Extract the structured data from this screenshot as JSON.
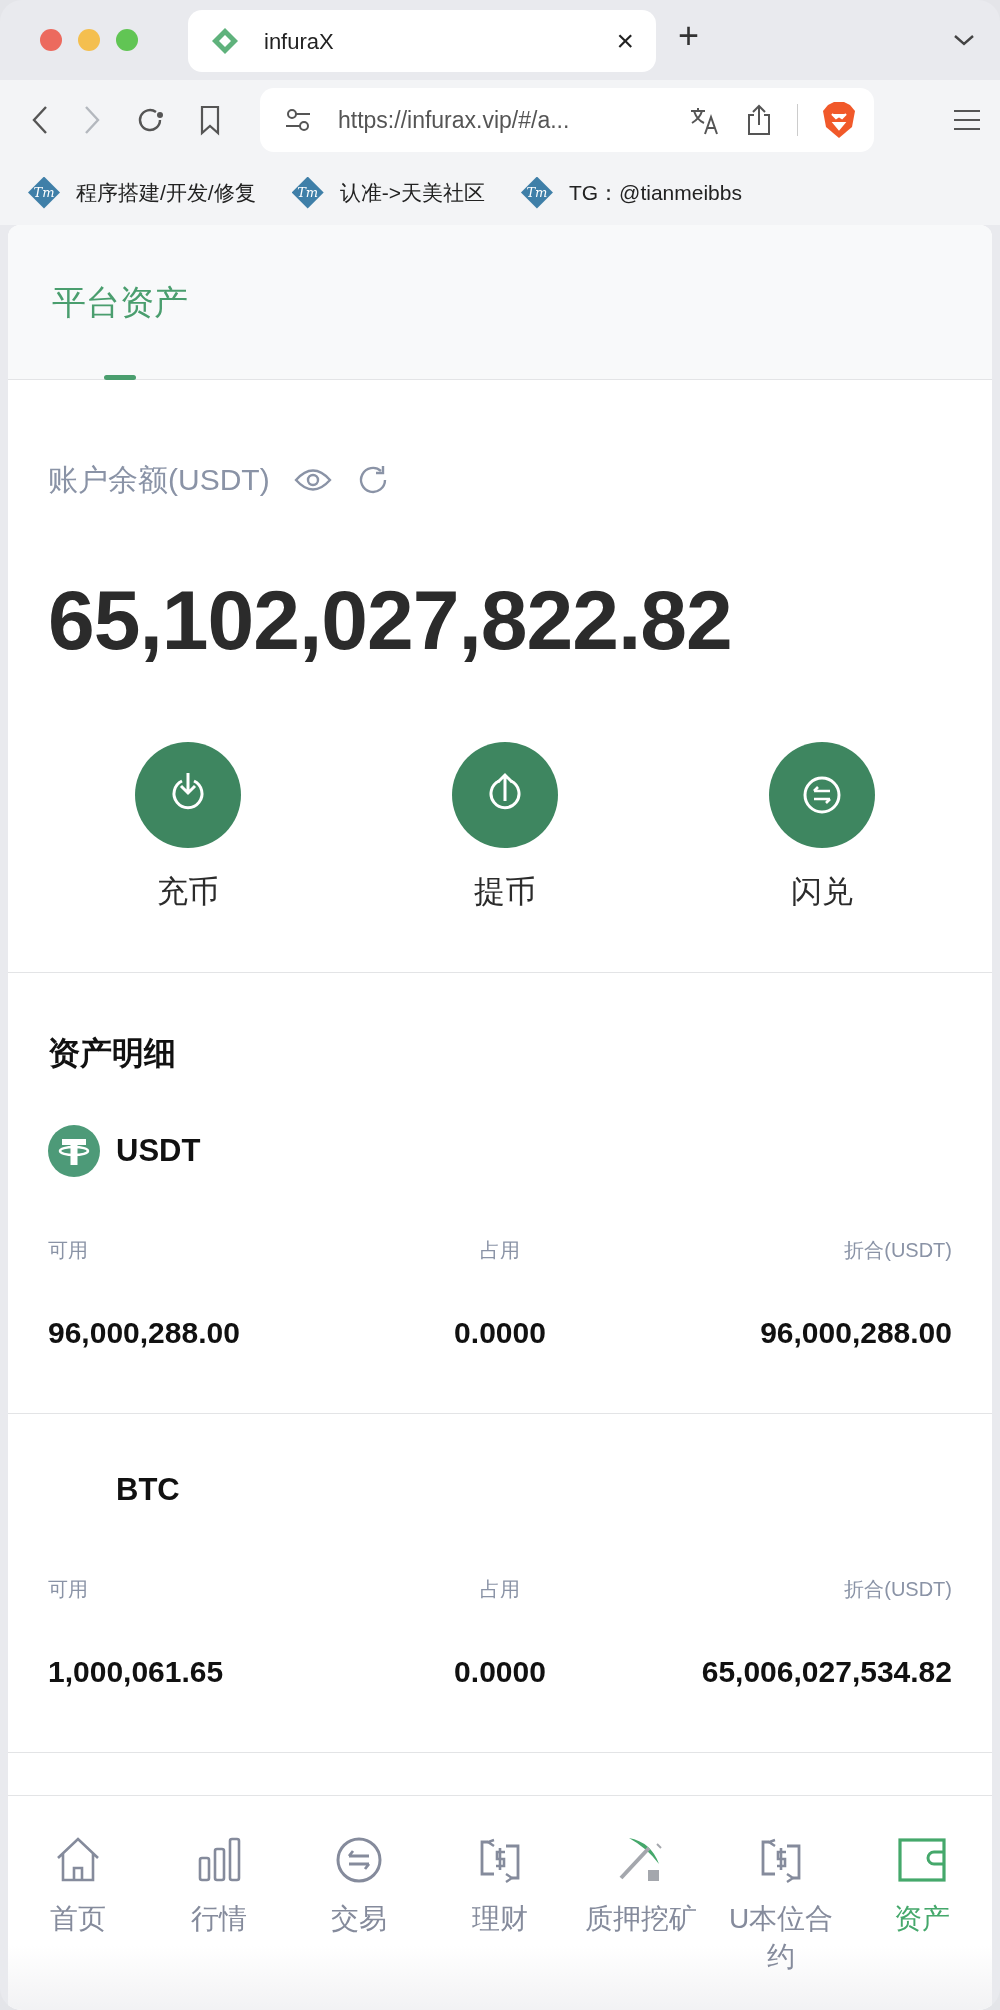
{
  "browser": {
    "tab_title": "infuraX",
    "tab_close": "×",
    "new_tab": "+",
    "url": "https://infurax.vip/#/a...",
    "forward_disabled": true,
    "bookmarks": [
      {
        "badge": "Tm",
        "label": "程序搭建/开发/修复"
      },
      {
        "badge": "Tm",
        "label": "认准->天美社区"
      },
      {
        "badge": "Tm",
        "label": "TG：@tianmeibbs"
      }
    ]
  },
  "tabs": [
    {
      "label": "平台资产",
      "selected": true
    }
  ],
  "balance": {
    "label": "账户余额(USDT)",
    "amount": "65,102,027,822.82"
  },
  "actions": [
    {
      "kind": "deposit",
      "label": "充币"
    },
    {
      "kind": "withdraw",
      "label": "提币"
    },
    {
      "kind": "swap",
      "label": "闪兑"
    }
  ],
  "section_title": "资产明细",
  "assets": [
    {
      "symbol": "USDT",
      "kind": "tether",
      "columns": [
        {
          "label": "可用",
          "value": "96,000,288.00"
        },
        {
          "label": "占用",
          "value": "0.0000"
        },
        {
          "label": "折合(USDT)",
          "value": "96,000,288.00"
        }
      ]
    },
    {
      "symbol": "BTC",
      "columns": [
        {
          "label": "可用",
          "value": "1,000,061.65"
        },
        {
          "label": "占用",
          "value": "0.0000"
        },
        {
          "label": "折合(USDT)",
          "value": "65,006,027,534.82"
        }
      ]
    }
  ],
  "nav": [
    {
      "kind": "home",
      "label": "首页",
      "selected": false
    },
    {
      "kind": "bars",
      "label": "行情",
      "selected": false
    },
    {
      "kind": "exchange",
      "label": "交易",
      "selected": false
    },
    {
      "kind": "dollar",
      "label": "理财",
      "selected": false
    },
    {
      "kind": "pick",
      "label": "质押挖矿",
      "selected": false
    },
    {
      "kind": "dollar",
      "label": "U本位合约",
      "selected": false
    },
    {
      "kind": "wallet",
      "label": "资产",
      "selected": true
    }
  ]
}
